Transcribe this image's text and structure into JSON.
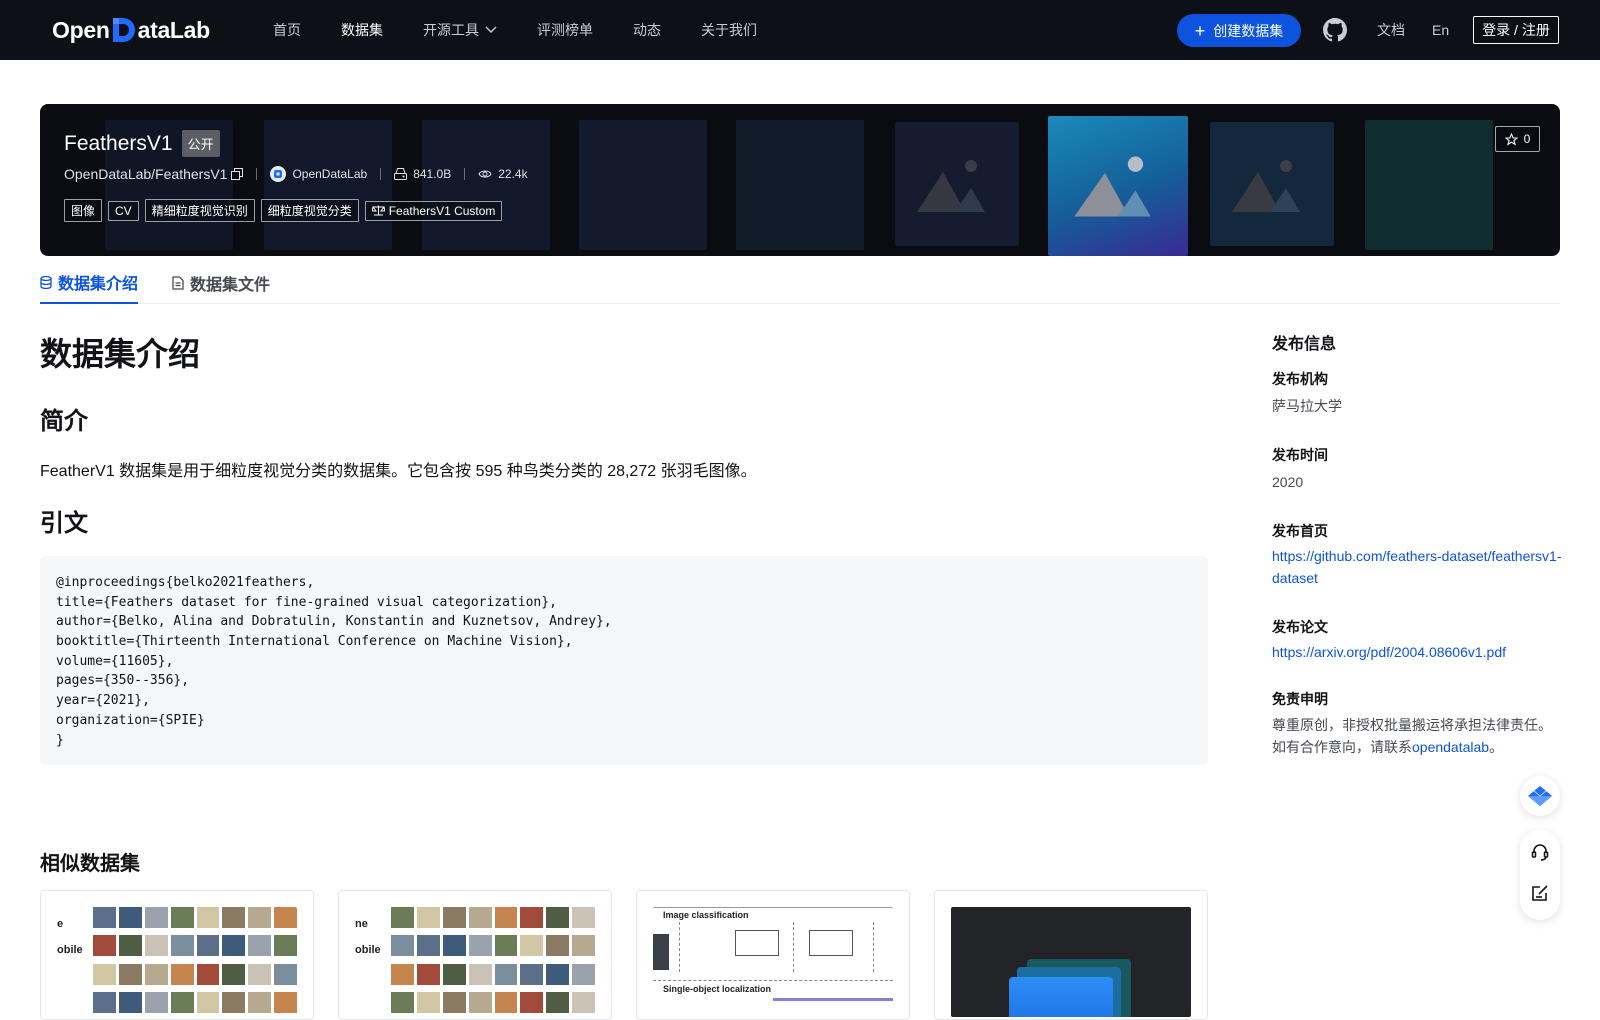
{
  "nav": {
    "logo_left": "Open",
    "logo_right": "ataLab",
    "links": [
      {
        "label": "首页"
      },
      {
        "label": "数据集"
      },
      {
        "label": "开源工具"
      },
      {
        "label": "评测榜单"
      },
      {
        "label": "动态"
      },
      {
        "label": "关于我们"
      }
    ],
    "create_label": "创建数据集",
    "docs_label": "文档",
    "lang_label": "En",
    "login_label": "登录 / 注册"
  },
  "dataset": {
    "name": "FeathersV1",
    "visibility": "公开",
    "full_path": "OpenDataLab/FeathersV1",
    "publisher": "OpenDataLab",
    "size": "841.0B",
    "views": "22.4k",
    "stars": "0",
    "tags": [
      "图像",
      "CV",
      "精细粒度视觉识别",
      "细粒度视觉分类"
    ],
    "license": "FeathersV1 Custom"
  },
  "tabs": [
    {
      "label": "数据集介绍"
    },
    {
      "label": "数据集文件"
    }
  ],
  "content": {
    "h1": "数据集介绍",
    "intro_heading": "简介",
    "intro_text": "FeatherV1 数据集是用于细粒度视觉分类的数据集。它包含按 595 种鸟类分类的 28,272 张羽毛图像。",
    "citation_heading": "引文",
    "citation_lines": [
      "@inproceedings{belko2021feathers,",
      "title={Feathers dataset for fine-grained visual categorization},",
      "author={Belko, Alina and Dobratulin, Konstantin and Kuznetsov, Andrey},",
      "booktitle={Thirteenth International Conference on Machine Vision},",
      "volume={11605},",
      "pages={350--356},",
      "year={2021},",
      "organization={SPIE}",
      "}"
    ],
    "similar_heading": "相似数据集",
    "card1_text": [
      "e",
      "obile"
    ],
    "card2_text": [
      "ne",
      "obile"
    ],
    "card3_text": [
      "Image classification",
      "Single-object localization"
    ]
  },
  "sidebar": {
    "title": "发布信息",
    "org_label": "发布机构",
    "org_value": "萨马拉大学",
    "time_label": "发布时间",
    "time_value": "2020",
    "home_label": "发布首页",
    "home_value": "https://github.com/feathers-dataset/feathersv1-dataset",
    "paper_label": "发布论文",
    "paper_value": "https://arxiv.org/pdf/2004.08606v1.pdf",
    "disclaimer_label": "免责申明",
    "disclaimer_line1": "尊重原创，非授权批量搬运将承担法律责任。",
    "disclaimer_line2_prefix": "如有合作意向，请联系",
    "disclaimer_link": "opendatalab",
    "disclaimer_suffix": "。"
  },
  "colors": {
    "brand": "#0d53de",
    "nav_bg": "#0d1117",
    "banner_bg": "#0a0c12"
  }
}
